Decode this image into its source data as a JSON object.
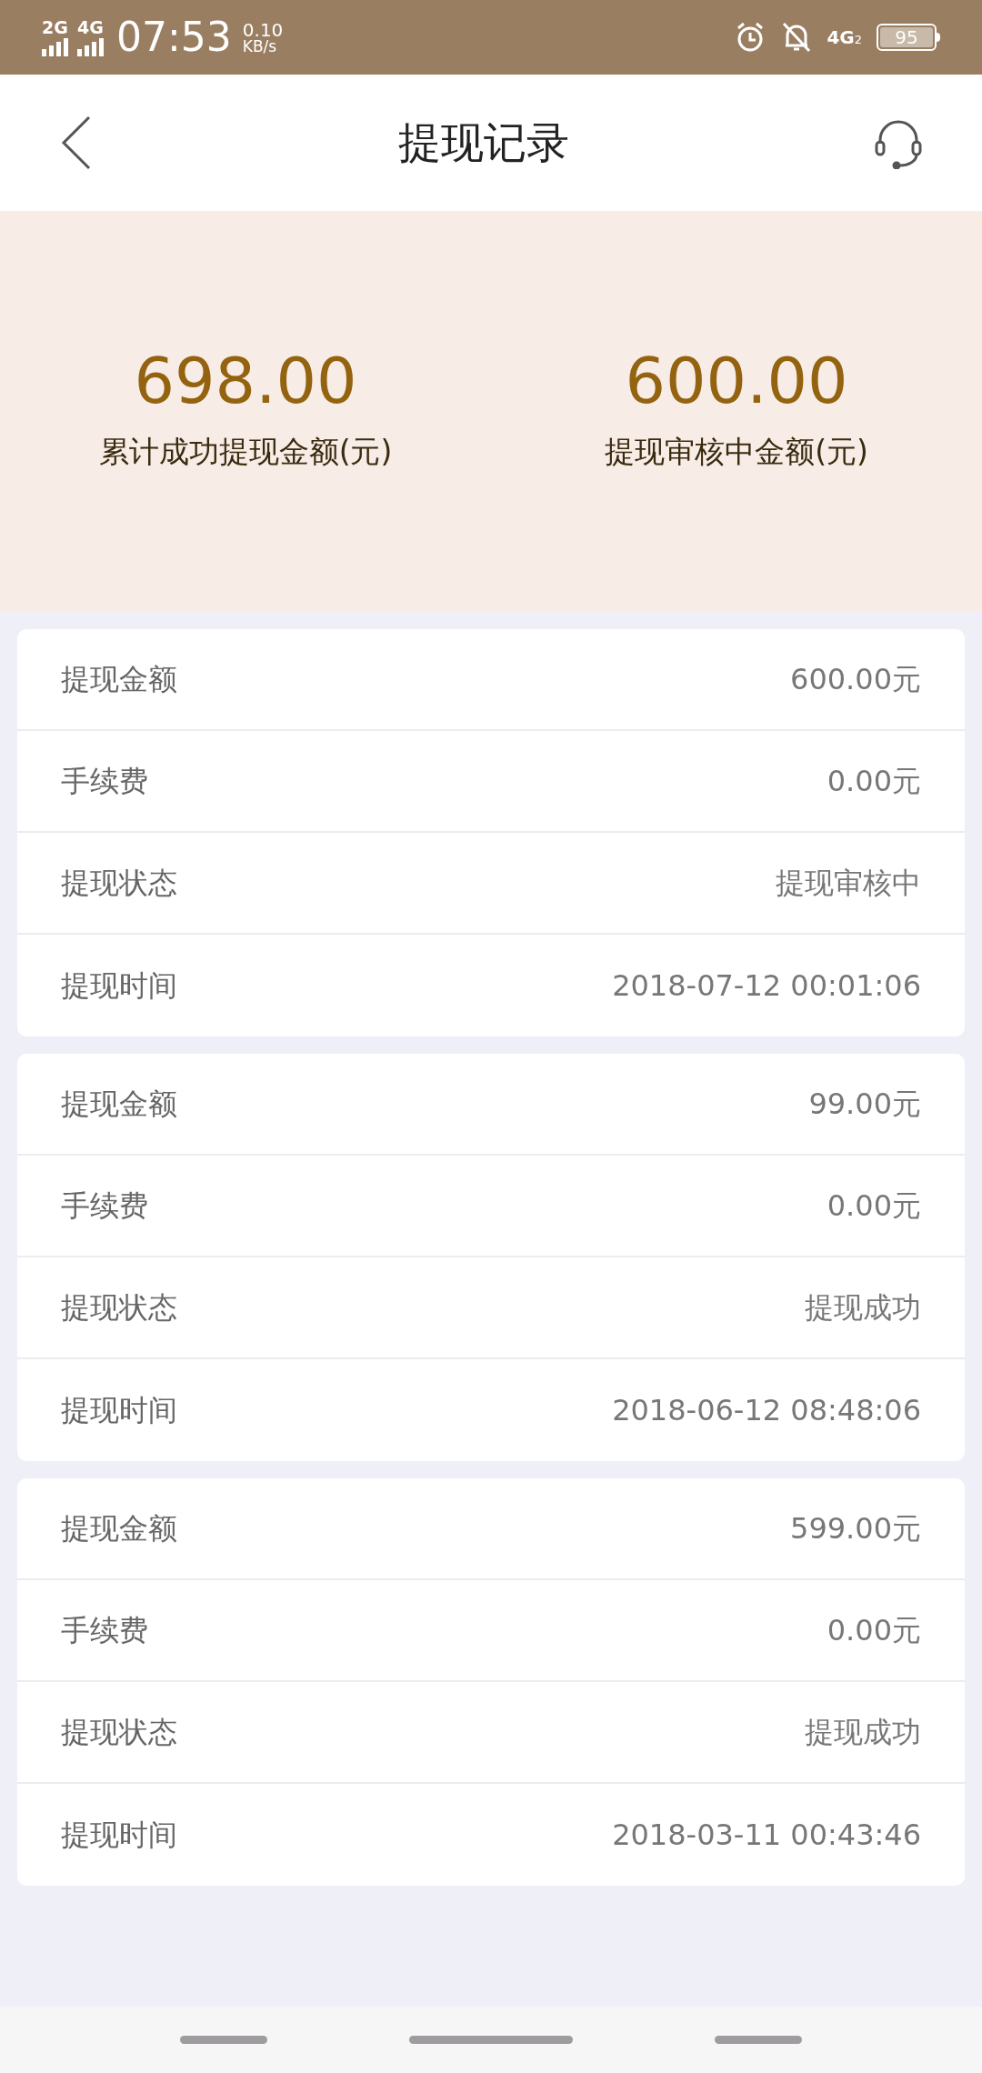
{
  "status_bar": {
    "networks": [
      "2G",
      "4G"
    ],
    "time": "07:53",
    "speed": "0.10",
    "speed_unit": "KB/s",
    "network_right": "4G",
    "sim": "2",
    "battery": "95"
  },
  "header": {
    "title": "提现记录"
  },
  "summary": [
    {
      "amount": "698.00",
      "label": "累计成功提现金额(元)"
    },
    {
      "amount": "600.00",
      "label": "提现审核中金额(元)"
    }
  ],
  "records": [
    {
      "rows": [
        {
          "label": "提现金额",
          "value": "600.00元"
        },
        {
          "label": "手续费",
          "value": "0.00元"
        },
        {
          "label": "提现状态",
          "value": "提现审核中"
        },
        {
          "label": "提现时间",
          "value": "2018-07-12 00:01:06"
        }
      ]
    },
    {
      "rows": [
        {
          "label": "提现金额",
          "value": "99.00元"
        },
        {
          "label": "手续费",
          "value": "0.00元"
        },
        {
          "label": "提现状态",
          "value": "提现成功"
        },
        {
          "label": "提现时间",
          "value": "2018-06-12 08:48:06"
        }
      ]
    },
    {
      "rows": [
        {
          "label": "提现金额",
          "value": "599.00元"
        },
        {
          "label": "手续费",
          "value": "0.00元"
        },
        {
          "label": "提现状态",
          "value": "提现成功"
        },
        {
          "label": "提现时间",
          "value": "2018-03-11 00:43:46"
        }
      ]
    }
  ]
}
